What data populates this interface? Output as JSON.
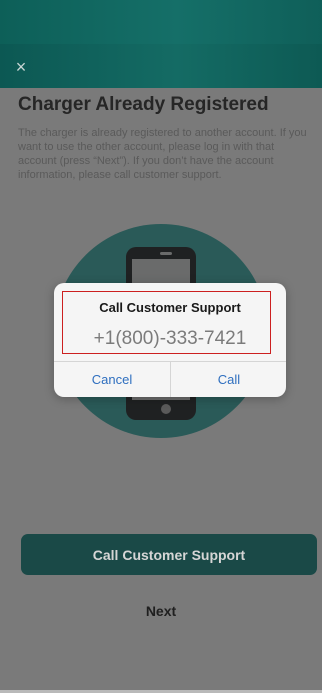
{
  "header": {
    "close_symbol": "×"
  },
  "main": {
    "title": "Charger Already Registered",
    "description": "The charger is already registered to another account. If you want to use the other account, please log in with that account (press “Next”). If you don’t have the account information, please call customer support."
  },
  "actions": {
    "primary_label": "Call Customer Support",
    "secondary_label": "Next"
  },
  "dialog": {
    "title": "Call Customer Support",
    "phone": "+1(800)-333-7421",
    "cancel_label": "Cancel",
    "call_label": "Call"
  },
  "icons": {
    "close": "close-icon",
    "phone": "phone-icon"
  },
  "colors": {
    "header_teal": "#146b64",
    "dim_background": "#7a7a7a",
    "primary_button": "#1a4947",
    "dialog_link_blue": "#2f6fbf",
    "highlight_red": "#cc1f1f"
  }
}
